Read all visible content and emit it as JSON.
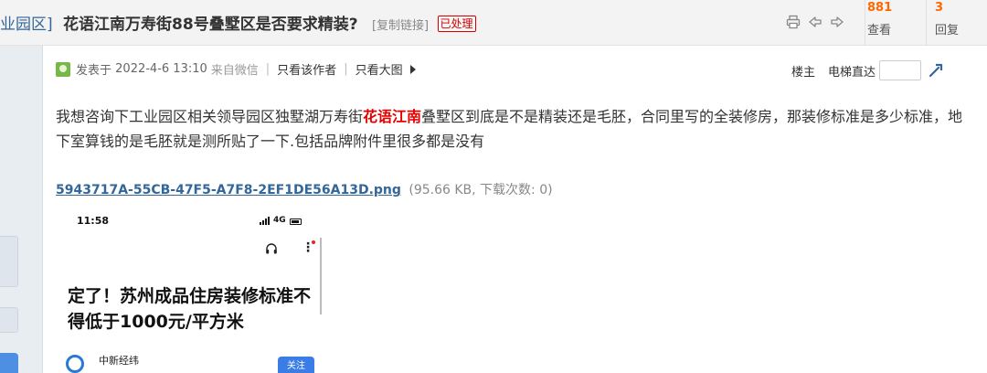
{
  "header": {
    "category": "业园区]",
    "title": "花语江南万寿街88号叠墅区是否要求精装?",
    "copy_link": "[复制链接]",
    "status_badge": "已处理",
    "views_count": "881",
    "views_label": "查看",
    "replies_count": "3",
    "replies_label": "回复",
    "icons": [
      "print-icon",
      "prev-icon",
      "next-icon"
    ]
  },
  "post": {
    "meta_prefix": "发表于",
    "datetime": "2022-4-6 13:10",
    "source": "来自微信",
    "only_author": "只看该作者",
    "only_large_images": "只看大图",
    "floor_owner": "楼主",
    "elevator": "电梯直达",
    "floor_input_value": "",
    "body_part1": "我想咨询下工业园区相关领导园区独墅湖万寿街",
    "body_highlight": "花语江南",
    "body_part2": "叠墅区到底是不是精装还是毛胚，合同里写的全装修房，那装修标准是多少标准，地下室算钱的是毛胚就是测所贴了一下.包括品牌附件里很多都是没有",
    "attachment_name": "5943717A-55CB-47F5-A7F8-2EF1DE56A13D.png",
    "attachment_info": "(95.66 KB, 下载次数: 0)"
  },
  "phone_screenshot": {
    "time": "11:58",
    "network": "4G",
    "headline": "定了！苏州成品住房装修标准不得低于1000元/平方米",
    "source_name": "中新经纬",
    "follow_label": "关注"
  },
  "colors": {
    "accent_link": "#336699",
    "highlight": "#e60000",
    "count": "#ff6600",
    "follow_button": "#3a7de6"
  }
}
